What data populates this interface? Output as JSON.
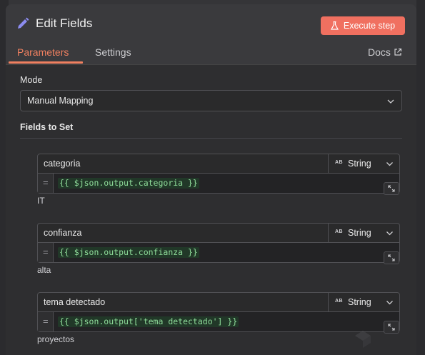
{
  "header": {
    "title": "Edit Fields",
    "execute_label": "Execute step"
  },
  "tabs": {
    "parameters": "Parameters",
    "settings": "Settings",
    "docs": "Docs"
  },
  "mode": {
    "label": "Mode",
    "value": "Manual Mapping"
  },
  "fields_section": {
    "label": "Fields to Set"
  },
  "fields": [
    {
      "name": "categoria",
      "type_badge": "AB",
      "type": "String",
      "eq": "=",
      "expression": "{{ $json.output.categoria }}",
      "result": "IT"
    },
    {
      "name": "confianza",
      "type_badge": "AB",
      "type": "String",
      "eq": "=",
      "expression": "{{ $json.output.confianza }}",
      "result": "alta"
    },
    {
      "name": "tema detectado",
      "type_badge": "AB",
      "type": "String",
      "eq": "=",
      "expression": "{{ $json.output['tema detectado'] }}",
      "result": "proyectos"
    }
  ],
  "colors": {
    "accent": "#f08060",
    "execute_button": "#f07060",
    "expression_text": "#8fdc9a",
    "panel": "#3a3a3d"
  },
  "icons": {
    "title": "pencil-icon",
    "execute": "flask-icon",
    "docs": "external-link-icon",
    "select": "chevron-down-icon",
    "expand": "expand-icon"
  }
}
